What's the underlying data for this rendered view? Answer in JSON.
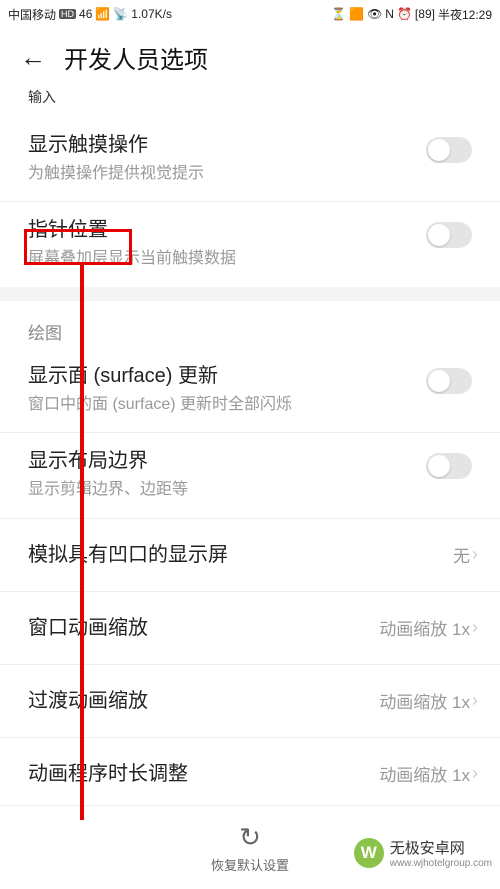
{
  "status_bar": {
    "carrier": "中国移动",
    "hd": "HD",
    "net": "46",
    "speed": "1.07K/s",
    "battery": "89",
    "time_label": "半夜12:29"
  },
  "header": {
    "title": "开发人员选项"
  },
  "truncated": "输入",
  "input_section": {
    "show_touch": {
      "title": "显示触摸操作",
      "sub": "为触摸操作提供视觉提示"
    },
    "pointer_loc": {
      "title": "指针位置",
      "sub": "屏幕叠加层显示当前触摸数据"
    }
  },
  "draw_header": "绘图",
  "draw_section": {
    "surface": {
      "title": "显示面 (surface) 更新",
      "sub": "窗口中的面 (surface) 更新时全部闪烁"
    },
    "layout": {
      "title": "显示布局边界",
      "sub": "显示剪辑边界、边距等"
    },
    "cutout": {
      "title": "模拟具有凹口的显示屏",
      "value": "无"
    },
    "window_anim": {
      "title": "窗口动画缩放",
      "value": "动画缩放 1x"
    },
    "transition_anim": {
      "title": "过渡动画缩放",
      "value": "动画缩放 1x"
    },
    "animator_dur": {
      "title": "动画程序时长调整",
      "value": "动画缩放 1x"
    }
  },
  "bottom": {
    "reset": "恢复默认设置"
  },
  "watermark": {
    "name": "无极安卓网",
    "url": "www.wjhotelgroup.com"
  }
}
